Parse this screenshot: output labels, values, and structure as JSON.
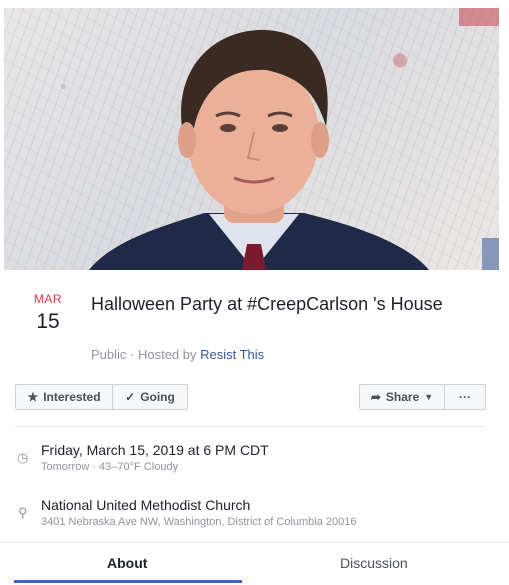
{
  "event": {
    "month": "MAR",
    "day": "15",
    "title": "Halloween Party at #CreepCarlson 's House",
    "visibility": "Public · Hosted by ",
    "host": "Resist This"
  },
  "actions": {
    "interested": "Interested",
    "going": "Going",
    "share": "Share",
    "more": "···"
  },
  "details": {
    "datetime": "Friday, March 15, 2019 at 6 PM CDT",
    "forecast": "Tomorrow · 43–70°F Cloudy",
    "venue": "National United Methodist Church",
    "address": "3401 Nebraska Ave NW, Washington, District of Columbia 20016"
  },
  "tabs": {
    "about": "About",
    "discussion": "Discussion"
  },
  "colors": {
    "month_red": "#e0393e",
    "link_blue": "#365899",
    "tab_active": "#4267b2"
  },
  "icons": {
    "interested": "star-icon",
    "going": "checkmark-icon",
    "share": "share-arrow-icon",
    "time": "clock-icon",
    "location": "map-pin-icon"
  }
}
